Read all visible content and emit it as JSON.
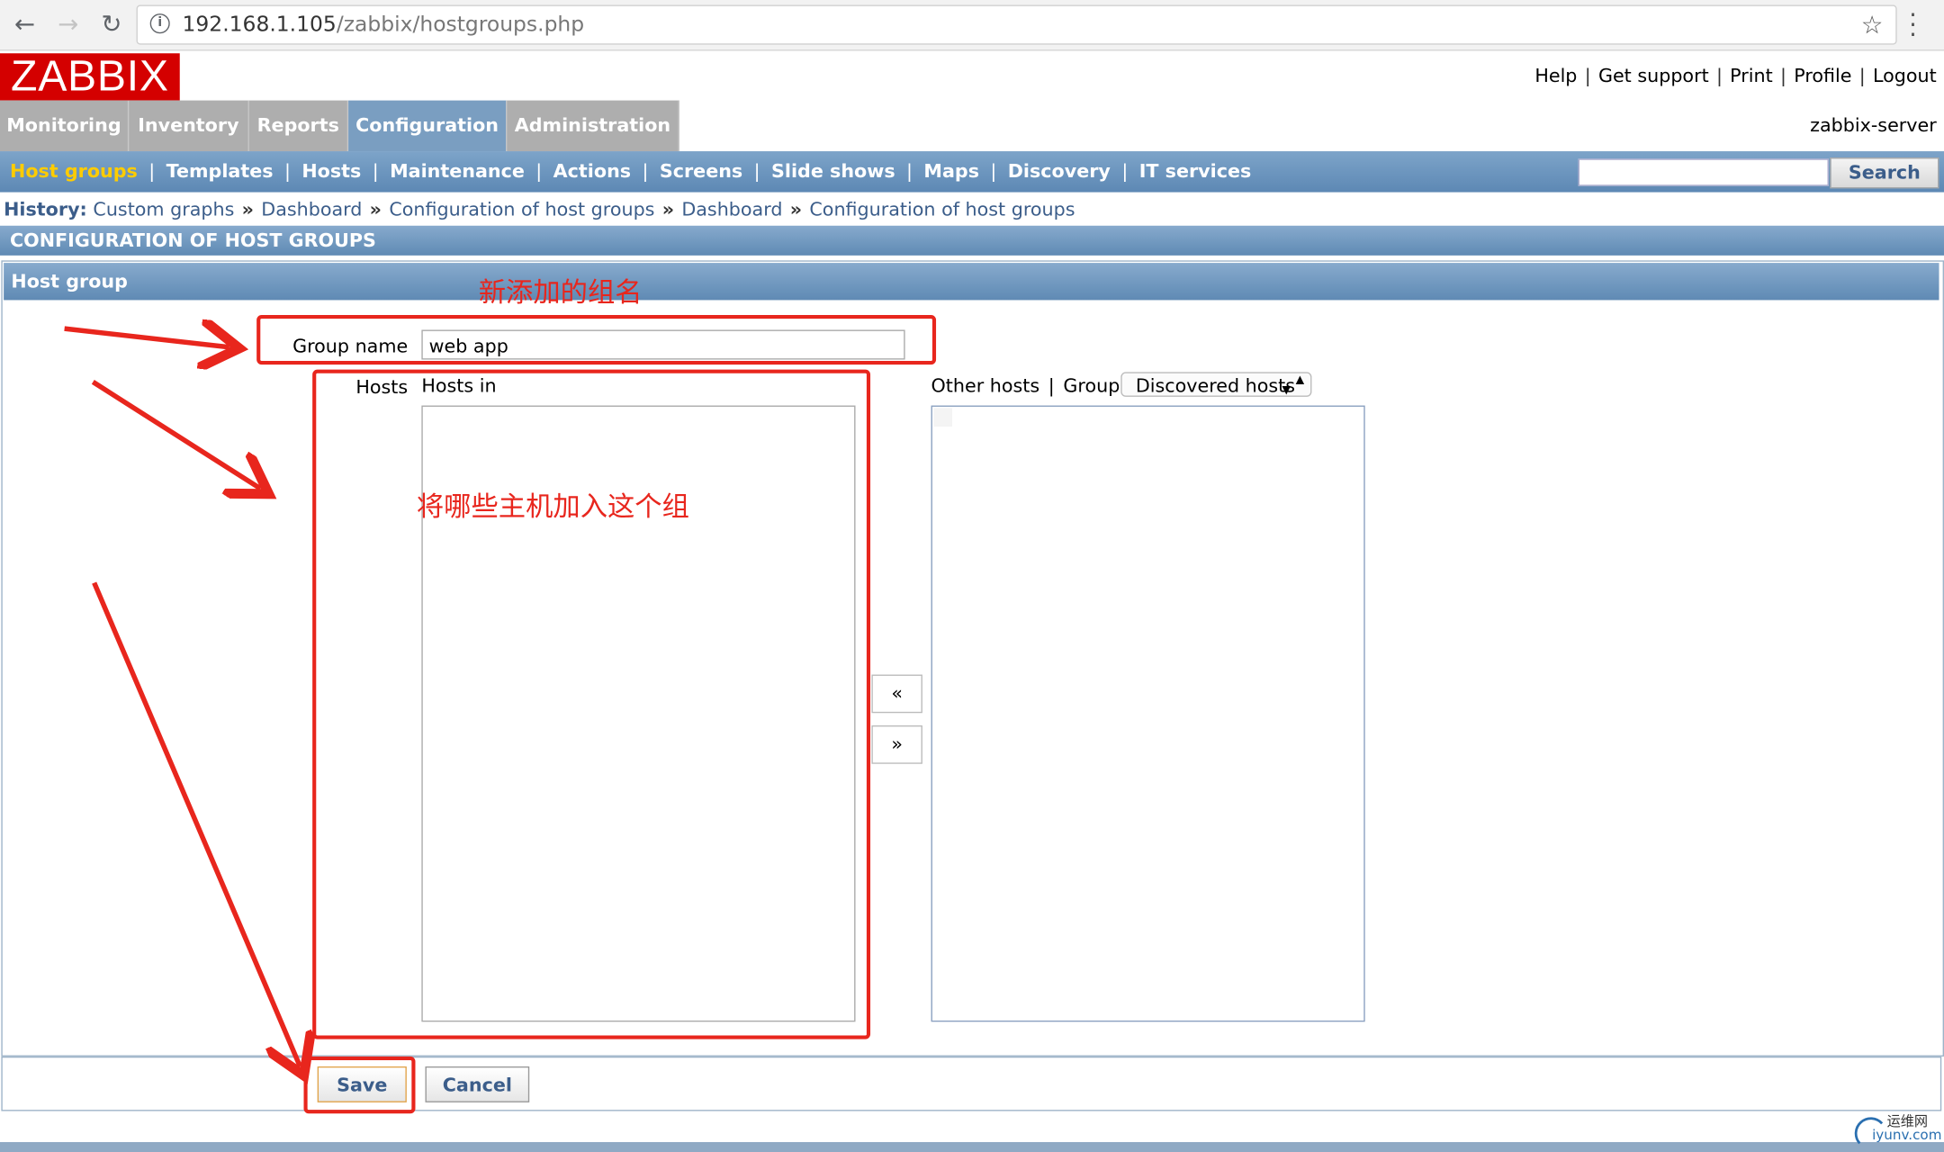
{
  "browser": {
    "url_host": "192.168.1.105",
    "url_path": "/zabbix/hostgroups.php"
  },
  "header": {
    "logo": "ZABBIX",
    "links": [
      "Help",
      "Get support",
      "Print",
      "Profile",
      "Logout"
    ],
    "server": "zabbix-server"
  },
  "main_nav": [
    "Monitoring",
    "Inventory",
    "Reports",
    "Configuration",
    "Administration"
  ],
  "main_nav_active": "Configuration",
  "sub_nav": [
    "Host groups",
    "Templates",
    "Hosts",
    "Maintenance",
    "Actions",
    "Screens",
    "Slide shows",
    "Maps",
    "Discovery",
    "IT services"
  ],
  "sub_nav_active": "Host groups",
  "search": {
    "button": "Search",
    "value": ""
  },
  "history": {
    "label": "History:",
    "items": [
      "Custom graphs",
      "Dashboard",
      "Configuration of host groups",
      "Dashboard",
      "Configuration of host groups"
    ]
  },
  "page_title": "CONFIGURATION OF HOST GROUPS",
  "form": {
    "title": "Host group",
    "group_name_label": "Group name",
    "group_name_value": "web app",
    "hosts_label": "Hosts",
    "hosts_in_label": "Hosts in",
    "other_hosts_label": "Other hosts",
    "group_label": "Group",
    "group_select_value": "Discovered hosts",
    "move_left": "«",
    "move_right": "»",
    "save": "Save",
    "cancel": "Cancel"
  },
  "annotations": {
    "group_name_note": "新添加的组名",
    "hosts_note": "将哪些主机加入这个组",
    "color": "#e8261d"
  },
  "watermark": {
    "line1": "运维网",
    "line2": "iyunv.com"
  },
  "colors": {
    "logo": "#d40000",
    "active_subnav": "#ffcc00",
    "active_tab": "#7a9ec1",
    "link": "#3b5d8a"
  }
}
